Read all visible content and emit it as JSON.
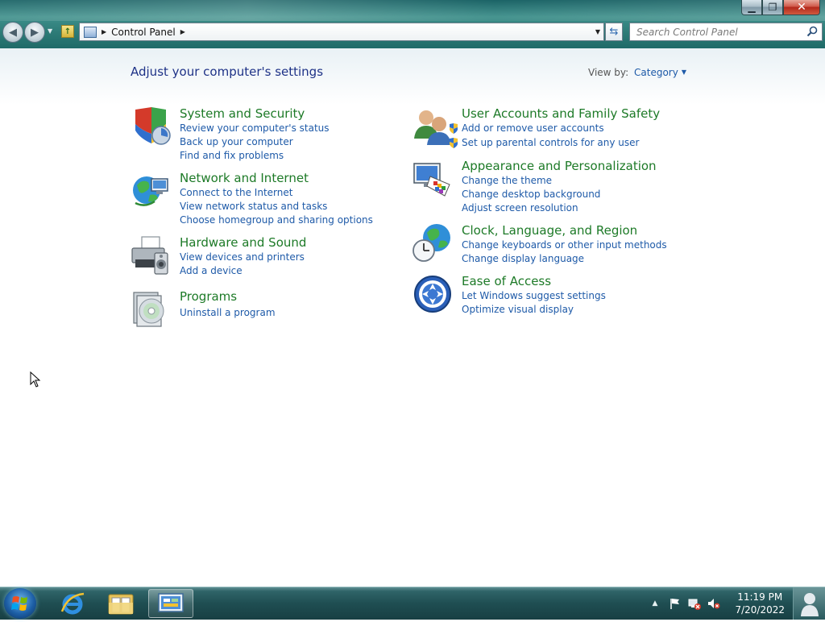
{
  "window": {
    "minimize_glyph": "▁",
    "maximize_glyph": "❐",
    "close_glyph": "✕"
  },
  "toolbar": {
    "back_glyph": "◀",
    "forward_glyph": "▶",
    "breadcrumb": [
      "Control Panel"
    ],
    "search_placeholder": "Search Control Panel"
  },
  "header": {
    "title": "Adjust your computer's settings",
    "view_by_label": "View by:",
    "view_by_value": "Category"
  },
  "categories": {
    "system": {
      "title": "System and Security",
      "icon": "shield-security-icon",
      "links": [
        "Review your computer's status",
        "Back up your computer",
        "Find and fix problems"
      ]
    },
    "network": {
      "title": "Network and Internet",
      "icon": "network-globe-icon",
      "links": [
        "Connect to the Internet",
        "View network status and tasks",
        "Choose homegroup and sharing options"
      ]
    },
    "hardware": {
      "title": "Hardware and Sound",
      "icon": "printer-speaker-icon",
      "links": [
        "View devices and printers",
        "Add a device"
      ]
    },
    "programs": {
      "title": "Programs",
      "icon": "programs-disc-icon",
      "links": [
        "Uninstall a program"
      ]
    },
    "users": {
      "title": "User Accounts and Family Safety",
      "icon": "users-icon",
      "links": [
        "Add or remove user accounts",
        "Set up parental controls for any user"
      ]
    },
    "appearance": {
      "title": "Appearance and Personalization",
      "icon": "monitor-palette-icon",
      "links": [
        "Change the theme",
        "Change desktop background",
        "Adjust screen resolution"
      ]
    },
    "clock": {
      "title": "Clock, Language, and Region",
      "icon": "clock-globe-icon",
      "links": [
        "Change keyboards or other input methods",
        "Change display language"
      ]
    },
    "ease": {
      "title": "Ease of Access",
      "icon": "ease-of-access-icon",
      "links": [
        "Let Windows suggest settings",
        "Optimize visual display"
      ]
    }
  },
  "taskbar": {
    "time": "11:19 PM",
    "date": "7/20/2022",
    "tray_arrow": "▲"
  },
  "colors": {
    "link": "#1e5aa8",
    "category_title": "#1d7a27",
    "page_title": "#1e3287"
  }
}
